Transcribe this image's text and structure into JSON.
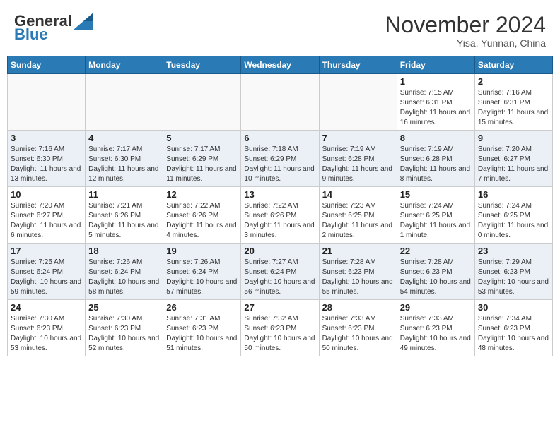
{
  "header": {
    "logo_general": "General",
    "logo_blue": "Blue",
    "month_year": "November 2024",
    "location": "Yisa, Yunnan, China"
  },
  "weekdays": [
    "Sunday",
    "Monday",
    "Tuesday",
    "Wednesday",
    "Thursday",
    "Friday",
    "Saturday"
  ],
  "weeks": [
    [
      {
        "day": "",
        "info": ""
      },
      {
        "day": "",
        "info": ""
      },
      {
        "day": "",
        "info": ""
      },
      {
        "day": "",
        "info": ""
      },
      {
        "day": "",
        "info": ""
      },
      {
        "day": "1",
        "info": "Sunrise: 7:15 AM\nSunset: 6:31 PM\nDaylight: 11 hours and 16 minutes."
      },
      {
        "day": "2",
        "info": "Sunrise: 7:16 AM\nSunset: 6:31 PM\nDaylight: 11 hours and 15 minutes."
      }
    ],
    [
      {
        "day": "3",
        "info": "Sunrise: 7:16 AM\nSunset: 6:30 PM\nDaylight: 11 hours and 13 minutes."
      },
      {
        "day": "4",
        "info": "Sunrise: 7:17 AM\nSunset: 6:30 PM\nDaylight: 11 hours and 12 minutes."
      },
      {
        "day": "5",
        "info": "Sunrise: 7:17 AM\nSunset: 6:29 PM\nDaylight: 11 hours and 11 minutes."
      },
      {
        "day": "6",
        "info": "Sunrise: 7:18 AM\nSunset: 6:29 PM\nDaylight: 11 hours and 10 minutes."
      },
      {
        "day": "7",
        "info": "Sunrise: 7:19 AM\nSunset: 6:28 PM\nDaylight: 11 hours and 9 minutes."
      },
      {
        "day": "8",
        "info": "Sunrise: 7:19 AM\nSunset: 6:28 PM\nDaylight: 11 hours and 8 minutes."
      },
      {
        "day": "9",
        "info": "Sunrise: 7:20 AM\nSunset: 6:27 PM\nDaylight: 11 hours and 7 minutes."
      }
    ],
    [
      {
        "day": "10",
        "info": "Sunrise: 7:20 AM\nSunset: 6:27 PM\nDaylight: 11 hours and 6 minutes."
      },
      {
        "day": "11",
        "info": "Sunrise: 7:21 AM\nSunset: 6:26 PM\nDaylight: 11 hours and 5 minutes."
      },
      {
        "day": "12",
        "info": "Sunrise: 7:22 AM\nSunset: 6:26 PM\nDaylight: 11 hours and 4 minutes."
      },
      {
        "day": "13",
        "info": "Sunrise: 7:22 AM\nSunset: 6:26 PM\nDaylight: 11 hours and 3 minutes."
      },
      {
        "day": "14",
        "info": "Sunrise: 7:23 AM\nSunset: 6:25 PM\nDaylight: 11 hours and 2 minutes."
      },
      {
        "day": "15",
        "info": "Sunrise: 7:24 AM\nSunset: 6:25 PM\nDaylight: 11 hours and 1 minute."
      },
      {
        "day": "16",
        "info": "Sunrise: 7:24 AM\nSunset: 6:25 PM\nDaylight: 11 hours and 0 minutes."
      }
    ],
    [
      {
        "day": "17",
        "info": "Sunrise: 7:25 AM\nSunset: 6:24 PM\nDaylight: 10 hours and 59 minutes."
      },
      {
        "day": "18",
        "info": "Sunrise: 7:26 AM\nSunset: 6:24 PM\nDaylight: 10 hours and 58 minutes."
      },
      {
        "day": "19",
        "info": "Sunrise: 7:26 AM\nSunset: 6:24 PM\nDaylight: 10 hours and 57 minutes."
      },
      {
        "day": "20",
        "info": "Sunrise: 7:27 AM\nSunset: 6:24 PM\nDaylight: 10 hours and 56 minutes."
      },
      {
        "day": "21",
        "info": "Sunrise: 7:28 AM\nSunset: 6:23 PM\nDaylight: 10 hours and 55 minutes."
      },
      {
        "day": "22",
        "info": "Sunrise: 7:28 AM\nSunset: 6:23 PM\nDaylight: 10 hours and 54 minutes."
      },
      {
        "day": "23",
        "info": "Sunrise: 7:29 AM\nSunset: 6:23 PM\nDaylight: 10 hours and 53 minutes."
      }
    ],
    [
      {
        "day": "24",
        "info": "Sunrise: 7:30 AM\nSunset: 6:23 PM\nDaylight: 10 hours and 53 minutes."
      },
      {
        "day": "25",
        "info": "Sunrise: 7:30 AM\nSunset: 6:23 PM\nDaylight: 10 hours and 52 minutes."
      },
      {
        "day": "26",
        "info": "Sunrise: 7:31 AM\nSunset: 6:23 PM\nDaylight: 10 hours and 51 minutes."
      },
      {
        "day": "27",
        "info": "Sunrise: 7:32 AM\nSunset: 6:23 PM\nDaylight: 10 hours and 50 minutes."
      },
      {
        "day": "28",
        "info": "Sunrise: 7:33 AM\nSunset: 6:23 PM\nDaylight: 10 hours and 50 minutes."
      },
      {
        "day": "29",
        "info": "Sunrise: 7:33 AM\nSunset: 6:23 PM\nDaylight: 10 hours and 49 minutes."
      },
      {
        "day": "30",
        "info": "Sunrise: 7:34 AM\nSunset: 6:23 PM\nDaylight: 10 hours and 48 minutes."
      }
    ]
  ]
}
